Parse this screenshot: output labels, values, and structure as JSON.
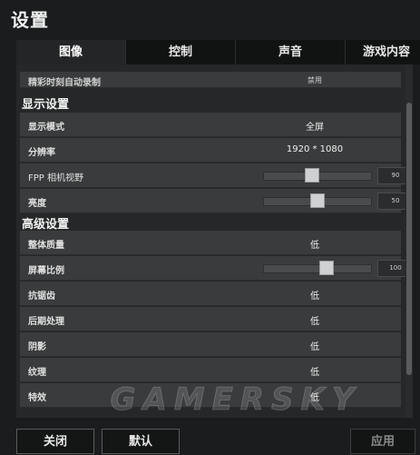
{
  "window": {
    "title": "设置"
  },
  "tabs": [
    {
      "label": "图像",
      "active": true
    },
    {
      "label": "控制",
      "active": false
    },
    {
      "label": "声音",
      "active": false
    },
    {
      "label": "游戏内容",
      "active": false
    }
  ],
  "rows": {
    "replay": {
      "label": "精彩时刻自动录制",
      "value": "禁用"
    },
    "display_mode": {
      "label": "显示模式",
      "value": "全屏"
    },
    "resolution": {
      "label": "分辨率",
      "value": "1920 * 1080"
    },
    "fpp_fov": {
      "label": "FPP 相机视野",
      "value": "90",
      "slider_fraction": 0.44
    },
    "brightness": {
      "label": "亮度",
      "value": "50",
      "slider_fraction": 0.5
    },
    "overall_quality": {
      "label": "整体质量",
      "value": "低"
    },
    "screen_scale": {
      "label": "屏幕比例",
      "value": "100",
      "slider_fraction": 0.6
    },
    "anti_aliasing": {
      "label": "抗锯齿",
      "value": "低"
    },
    "post_processing": {
      "label": "后期处理",
      "value": "低"
    },
    "shadows": {
      "label": "阴影",
      "value": "低"
    },
    "textures": {
      "label": "纹理",
      "value": "低"
    },
    "effects": {
      "label": "特效",
      "value": "低"
    }
  },
  "sections": {
    "display": "显示设置",
    "advanced": "高级设置"
  },
  "buttons": {
    "close": "关闭",
    "default": "默认",
    "apply": "应用"
  },
  "watermark": "GAMERSKY",
  "colors": {
    "background": "#1b1c1d",
    "panel": "#262728",
    "row": "#3a3b3c",
    "slider_thumb": "#cfd0d1"
  }
}
